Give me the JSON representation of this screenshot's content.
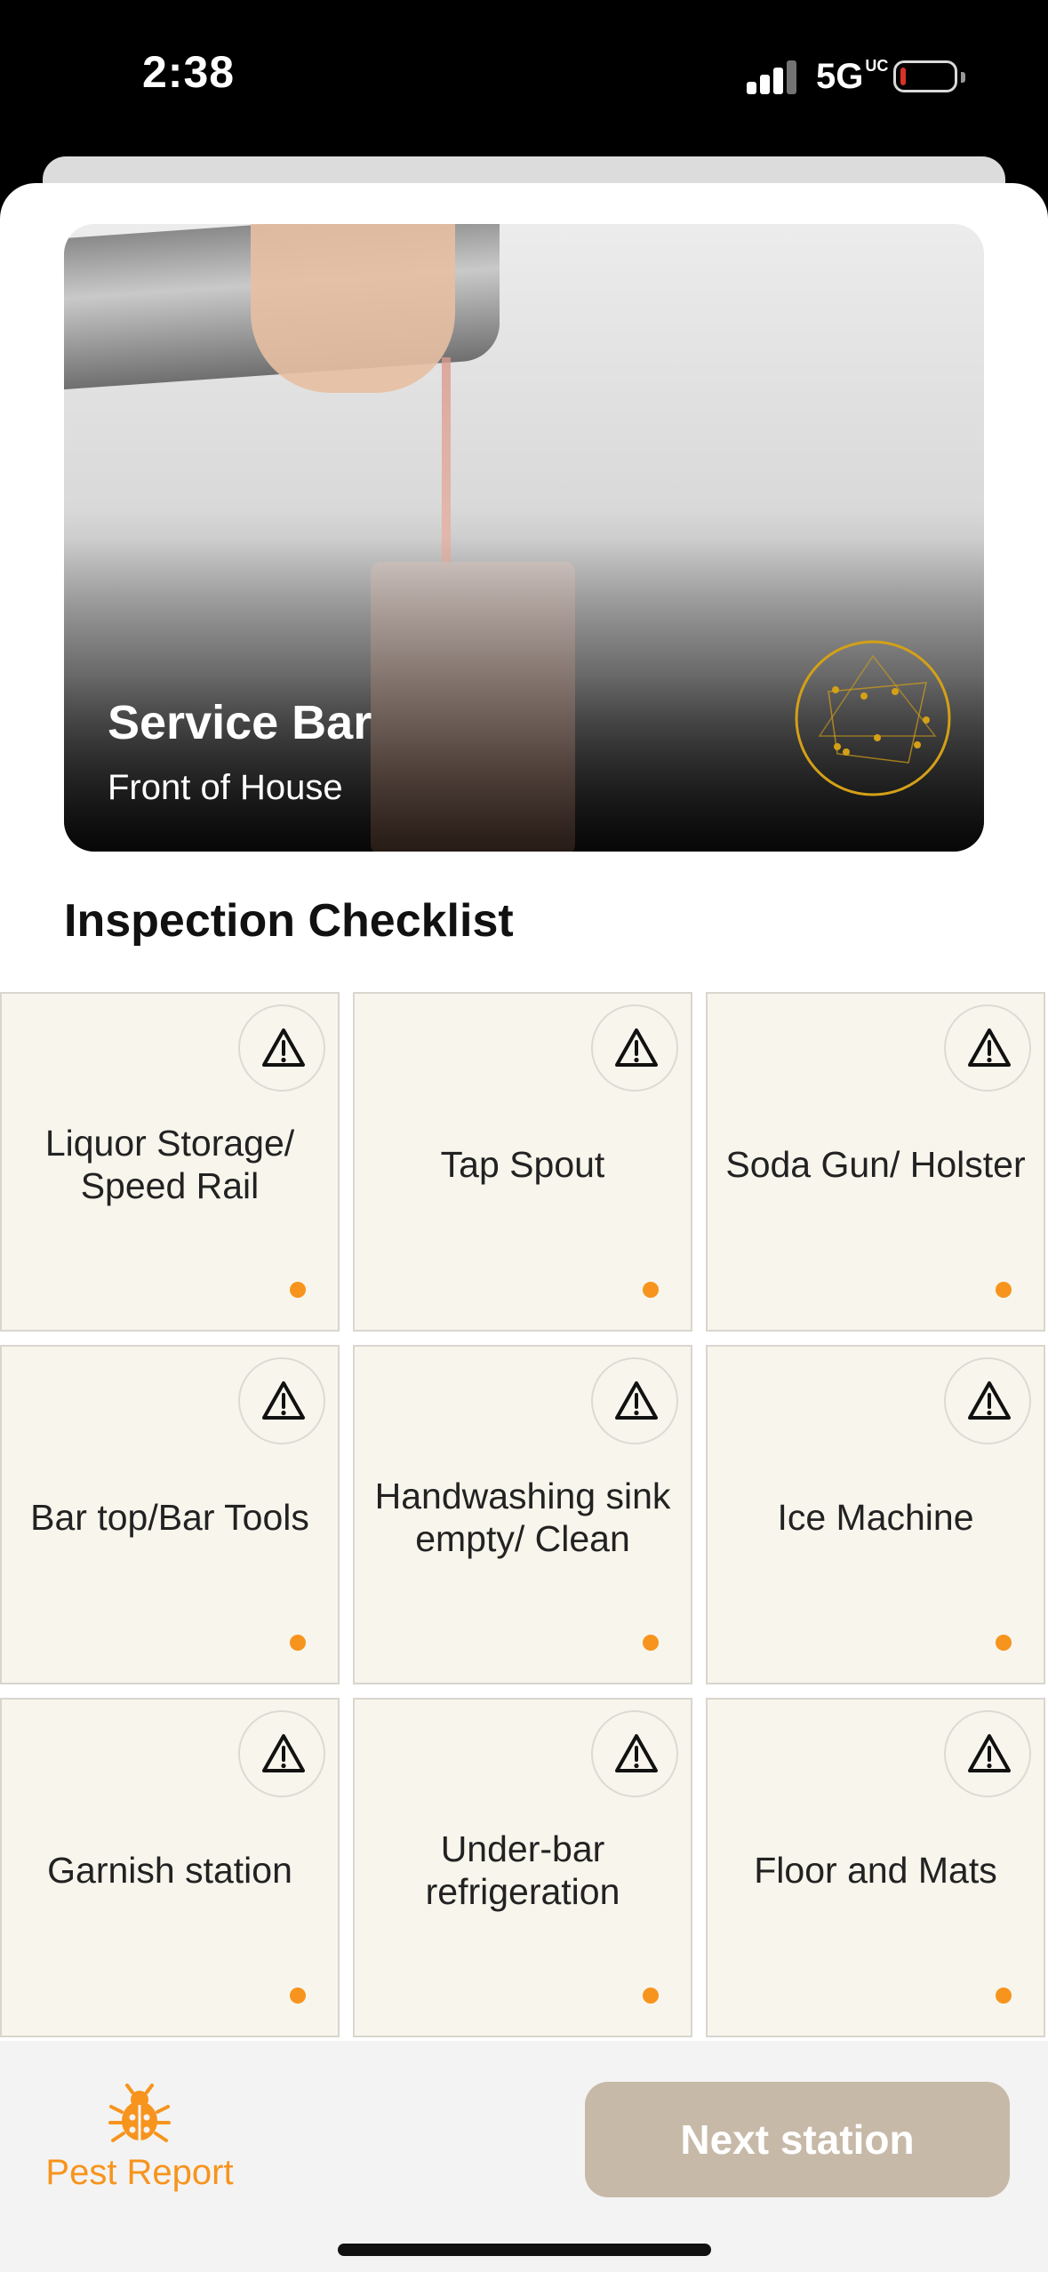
{
  "status_bar": {
    "time": "2:38",
    "network": "5G",
    "network_sup": "UC",
    "battery_color": "#ff3b30"
  },
  "hero": {
    "title": "Service Bar",
    "subtitle": "Front of House"
  },
  "section_title": "Inspection Checklist",
  "checklist": [
    {
      "label": "Liquor Storage/ Speed Rail",
      "status_icon": "warning-icon"
    },
    {
      "label": "Tap Spout",
      "status_icon": "warning-icon"
    },
    {
      "label": "Soda Gun/ Holster",
      "status_icon": "warning-icon"
    },
    {
      "label": "Bar top/Bar Tools",
      "status_icon": "warning-icon"
    },
    {
      "label": "Handwashing sink empty/ Clean",
      "status_icon": "warning-icon"
    },
    {
      "label": "Ice Machine",
      "status_icon": "warning-icon"
    },
    {
      "label": "Garnish station",
      "status_icon": "warning-icon"
    },
    {
      "label": "Under-bar refrigeration",
      "status_icon": "warning-icon"
    },
    {
      "label": "Floor and Mats",
      "status_icon": "warning-icon"
    }
  ],
  "bottom_bar": {
    "pest_label": "Pest Report",
    "next_label": "Next station"
  },
  "colors": {
    "accent": "#f7941d",
    "tile_bg": "#f7f5ec",
    "button_bg": "#c7b9a8"
  }
}
